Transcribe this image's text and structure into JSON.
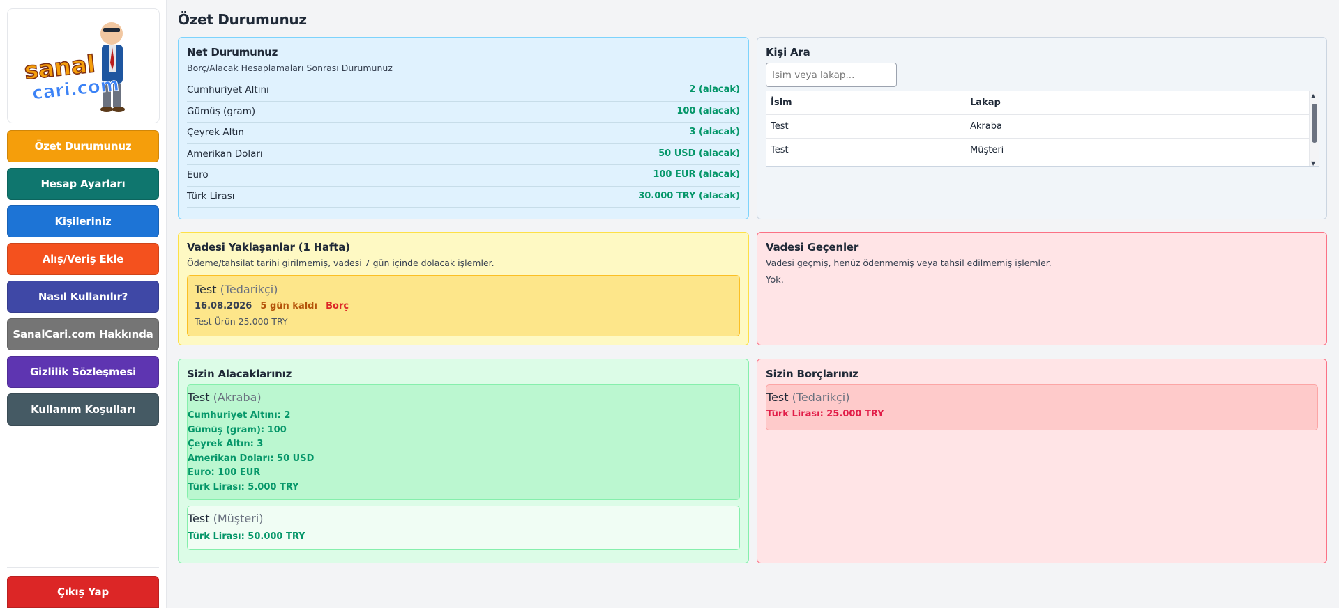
{
  "brand": {
    "logo_text_top": "sanal",
    "logo_text_bottom": "cari.com"
  },
  "nav": [
    {
      "label": "Özet Durumunuz",
      "color": "#f59e0b",
      "text": "#ffffff"
    },
    {
      "label": "Hesap Ayarları",
      "color": "#0f766e"
    },
    {
      "label": "Kişileriniz",
      "color": "#1d74d6"
    },
    {
      "label": "Alış/Veriş Ekle",
      "color": "#f4511e"
    },
    {
      "label": "Nasıl Kullanılır?",
      "color": "#3f48a6"
    },
    {
      "label": "SanalCari.com Hakkında",
      "color": "#757575"
    },
    {
      "label": "Gizlilik Sözleşmesi",
      "color": "#5e35b1"
    },
    {
      "label": "Kullanım Koşulları",
      "color": "#455a64"
    }
  ],
  "logout_label": "Çıkış Yap",
  "page_title": "Özet Durumunuz",
  "net": {
    "title": "Net Durumunuz",
    "subtitle": "Borç/Alacak Hesaplamaları Sonrası Durumunuz",
    "rows": [
      {
        "label": "Cumhuriyet Altını",
        "value": "2 (alacak)"
      },
      {
        "label": "Gümüş (gram)",
        "value": "100 (alacak)"
      },
      {
        "label": "Çeyrek Altın",
        "value": "3 (alacak)"
      },
      {
        "label": "Amerikan Doları",
        "value": "50 USD (alacak)"
      },
      {
        "label": "Euro",
        "value": "100 EUR (alacak)"
      },
      {
        "label": "Türk Lirası",
        "value": "30.000 TRY (alacak)"
      }
    ]
  },
  "search": {
    "title": "Kişi Ara",
    "placeholder": "İsim veya lakap...",
    "headers": [
      "İsim",
      "Lakap"
    ],
    "rows": [
      [
        "Test",
        "Akraba"
      ],
      [
        "Test",
        "Müşteri"
      ]
    ]
  },
  "due_soon": {
    "title": "Vadesi Yaklaşanlar (1 Hafta)",
    "subtitle": "Ödeme/tahsilat tarihi girilmemiş, vadesi 7 gün içinde dolacak işlemler.",
    "item": {
      "name": "Test",
      "role": "(Tedarikçi)",
      "date": "16.08.2026",
      "remaining": "5 gün kaldı",
      "type": "Borç",
      "desc": "Test Ürün 25.000 TRY"
    }
  },
  "overdue": {
    "title": "Vadesi Geçenler",
    "subtitle": "Vadesi geçmiş, henüz ödenmemiş veya tahsil edilmemiş işlemler.",
    "empty": "Yok."
  },
  "receivables": {
    "title": "Sizin Alacaklarınız",
    "items": [
      {
        "name": "Test",
        "role": "(Akraba)",
        "lines": [
          "Cumhuriyet Altını: 2",
          "Gümüş (gram): 100",
          "Çeyrek Altın: 3",
          "Amerikan Doları: 50 USD",
          "Euro: 100 EUR",
          "Türk Lirası: 5.000 TRY"
        ]
      },
      {
        "name": "Test",
        "role": "(Müşteri)",
        "lines": [
          "Türk Lirası: 50.000 TRY"
        ]
      }
    ]
  },
  "debts": {
    "title": "Sizin Borçlarınız",
    "items": [
      {
        "name": "Test",
        "role": "(Tedarikçi)",
        "lines": [
          "Türk Lirası: 25.000 TRY"
        ]
      }
    ]
  }
}
